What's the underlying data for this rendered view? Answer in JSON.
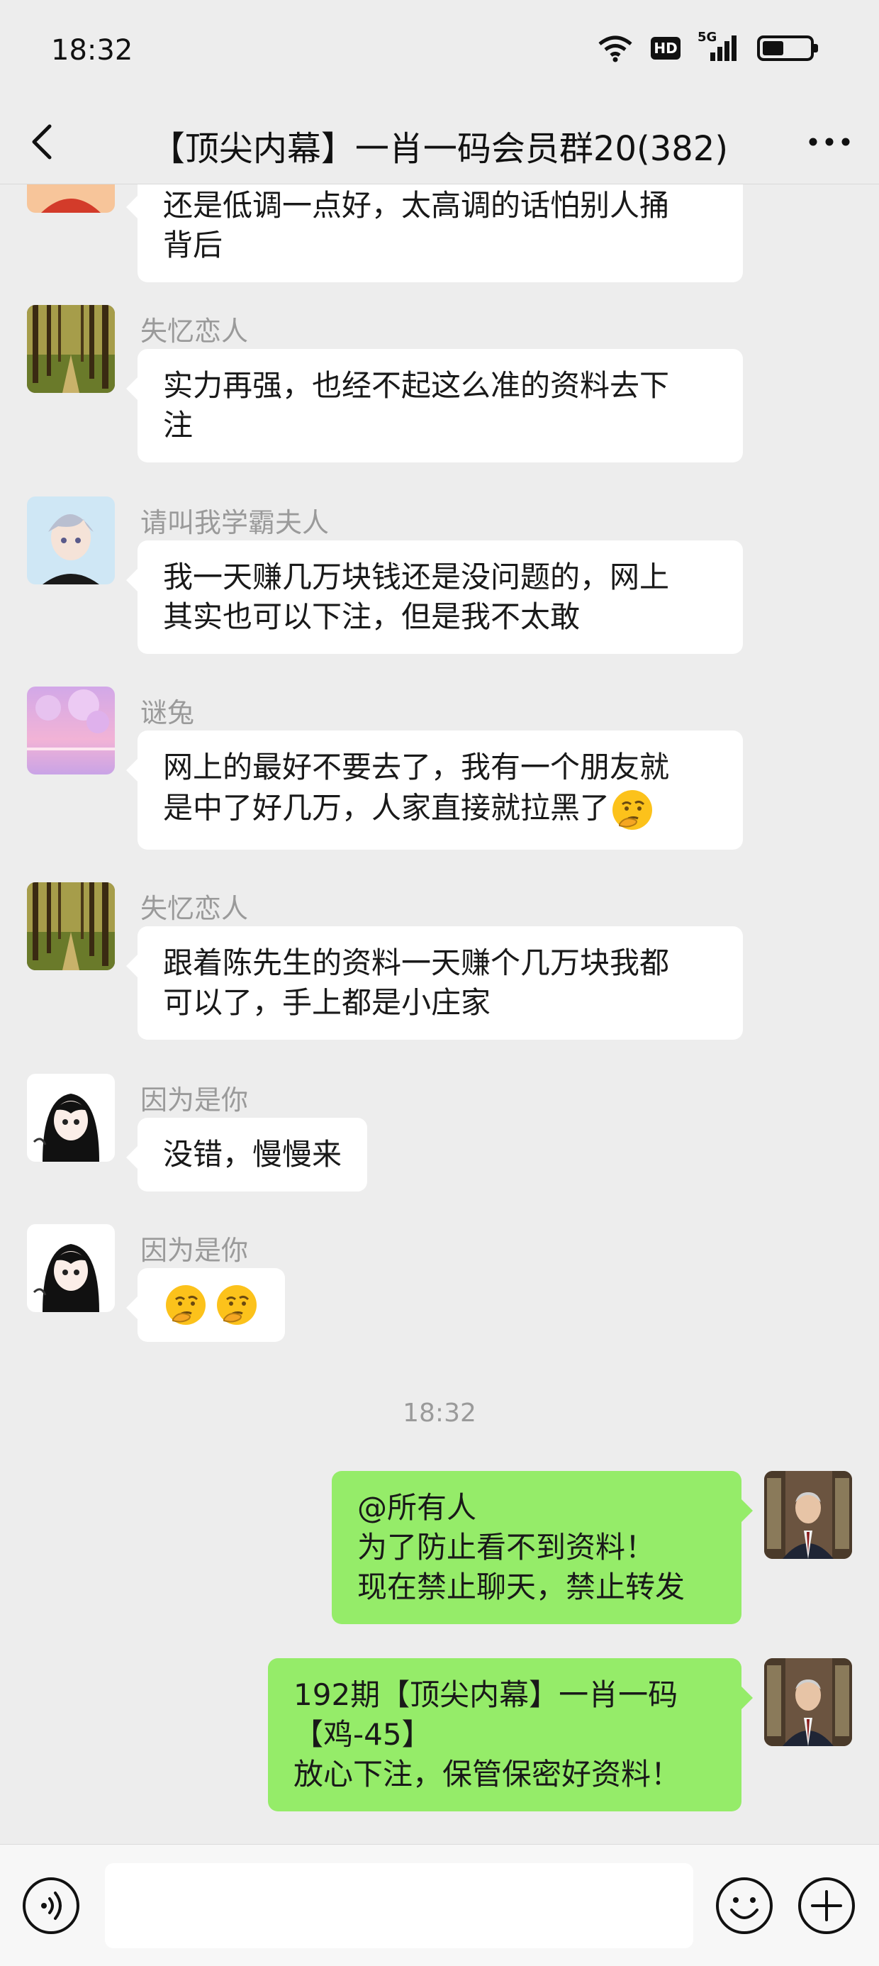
{
  "status_bar": {
    "time": "18:32",
    "hd_label": "HD",
    "network": "5G",
    "battery_level": 0.45
  },
  "header": {
    "title": "【顶尖内幕】一肖一码会员群20(382)"
  },
  "messages": [
    {
      "sender": "",
      "text_lines": [
        "还是低调一点好，太高调的话怕别人捅",
        "背后"
      ]
    },
    {
      "sender": "失忆恋人",
      "text_lines": [
        "实力再强，也经不起这么准的资料去下",
        "注"
      ]
    },
    {
      "sender": "请叫我学霸夫人",
      "text_lines": [
        "我一天赚几万块钱还是没问题的，网上",
        "其实也可以下注，但是我不太敢"
      ]
    },
    {
      "sender": "谜兔",
      "text_lines": [
        "网上的最好不要去了，我有一个朋友就",
        "是中了好几万，人家直接就拉黑了"
      ]
    },
    {
      "sender": "失忆恋人",
      "text_lines": [
        "跟着陈先生的资料一天赚个几万块我都",
        "可以了，手上都是小庄家"
      ]
    },
    {
      "sender": "因为是你",
      "text_lines": [
        "没错，慢慢来"
      ]
    },
    {
      "sender": "因为是你",
      "text_lines": []
    }
  ],
  "timestamp": "18:32",
  "own_messages": [
    {
      "text_lines": [
        "@所有人",
        "为了防止看不到资料！",
        "现在禁止聊天，禁止转发"
      ]
    },
    {
      "text_lines": [
        "192期【顶尖内幕】一肖一码",
        "【鸡-45】",
        "放心下注，保管保密好资料！"
      ]
    }
  ],
  "input": {
    "value": "",
    "placeholder": ""
  },
  "icons": {
    "back": "back-arrow-icon",
    "more": "more-dots-icon",
    "voice": "voice-icon",
    "emoji": "emoji-face-icon",
    "plus": "plus-icon",
    "reaction": "thinking-face-emoji"
  },
  "colors": {
    "background": "#ededed",
    "own_bubble": "#95ec69",
    "other_bubble": "#ffffff",
    "sender_name": "#9a9a9a"
  }
}
